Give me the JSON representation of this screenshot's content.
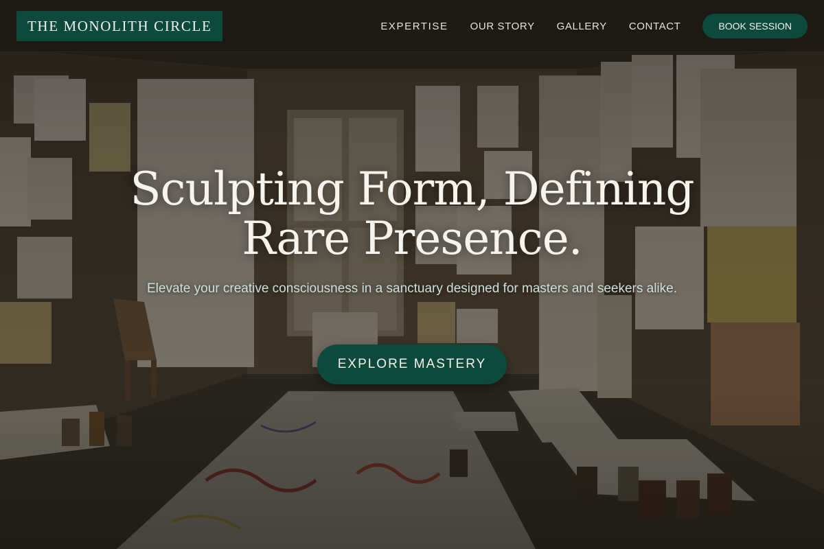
{
  "brand": {
    "name": "THE MONOLITH CIRCLE",
    "accent_color": "#0d4a3c"
  },
  "nav": {
    "items": [
      {
        "label": "EXPERTISE"
      },
      {
        "label": "OUR STORY"
      },
      {
        "label": "GALLERY"
      },
      {
        "label": "CONTACT"
      }
    ],
    "cta_label": "BOOK SESSION"
  },
  "hero": {
    "title_line1": "Sculpting Form, Defining",
    "title_line2": "Rare Presence.",
    "subtitle": "Elevate your creative consciousness in a sanctuary designed for masters and seekers alike.",
    "cta_label": "EXPLORE MASTERY",
    "background": "art-studio-photo"
  }
}
